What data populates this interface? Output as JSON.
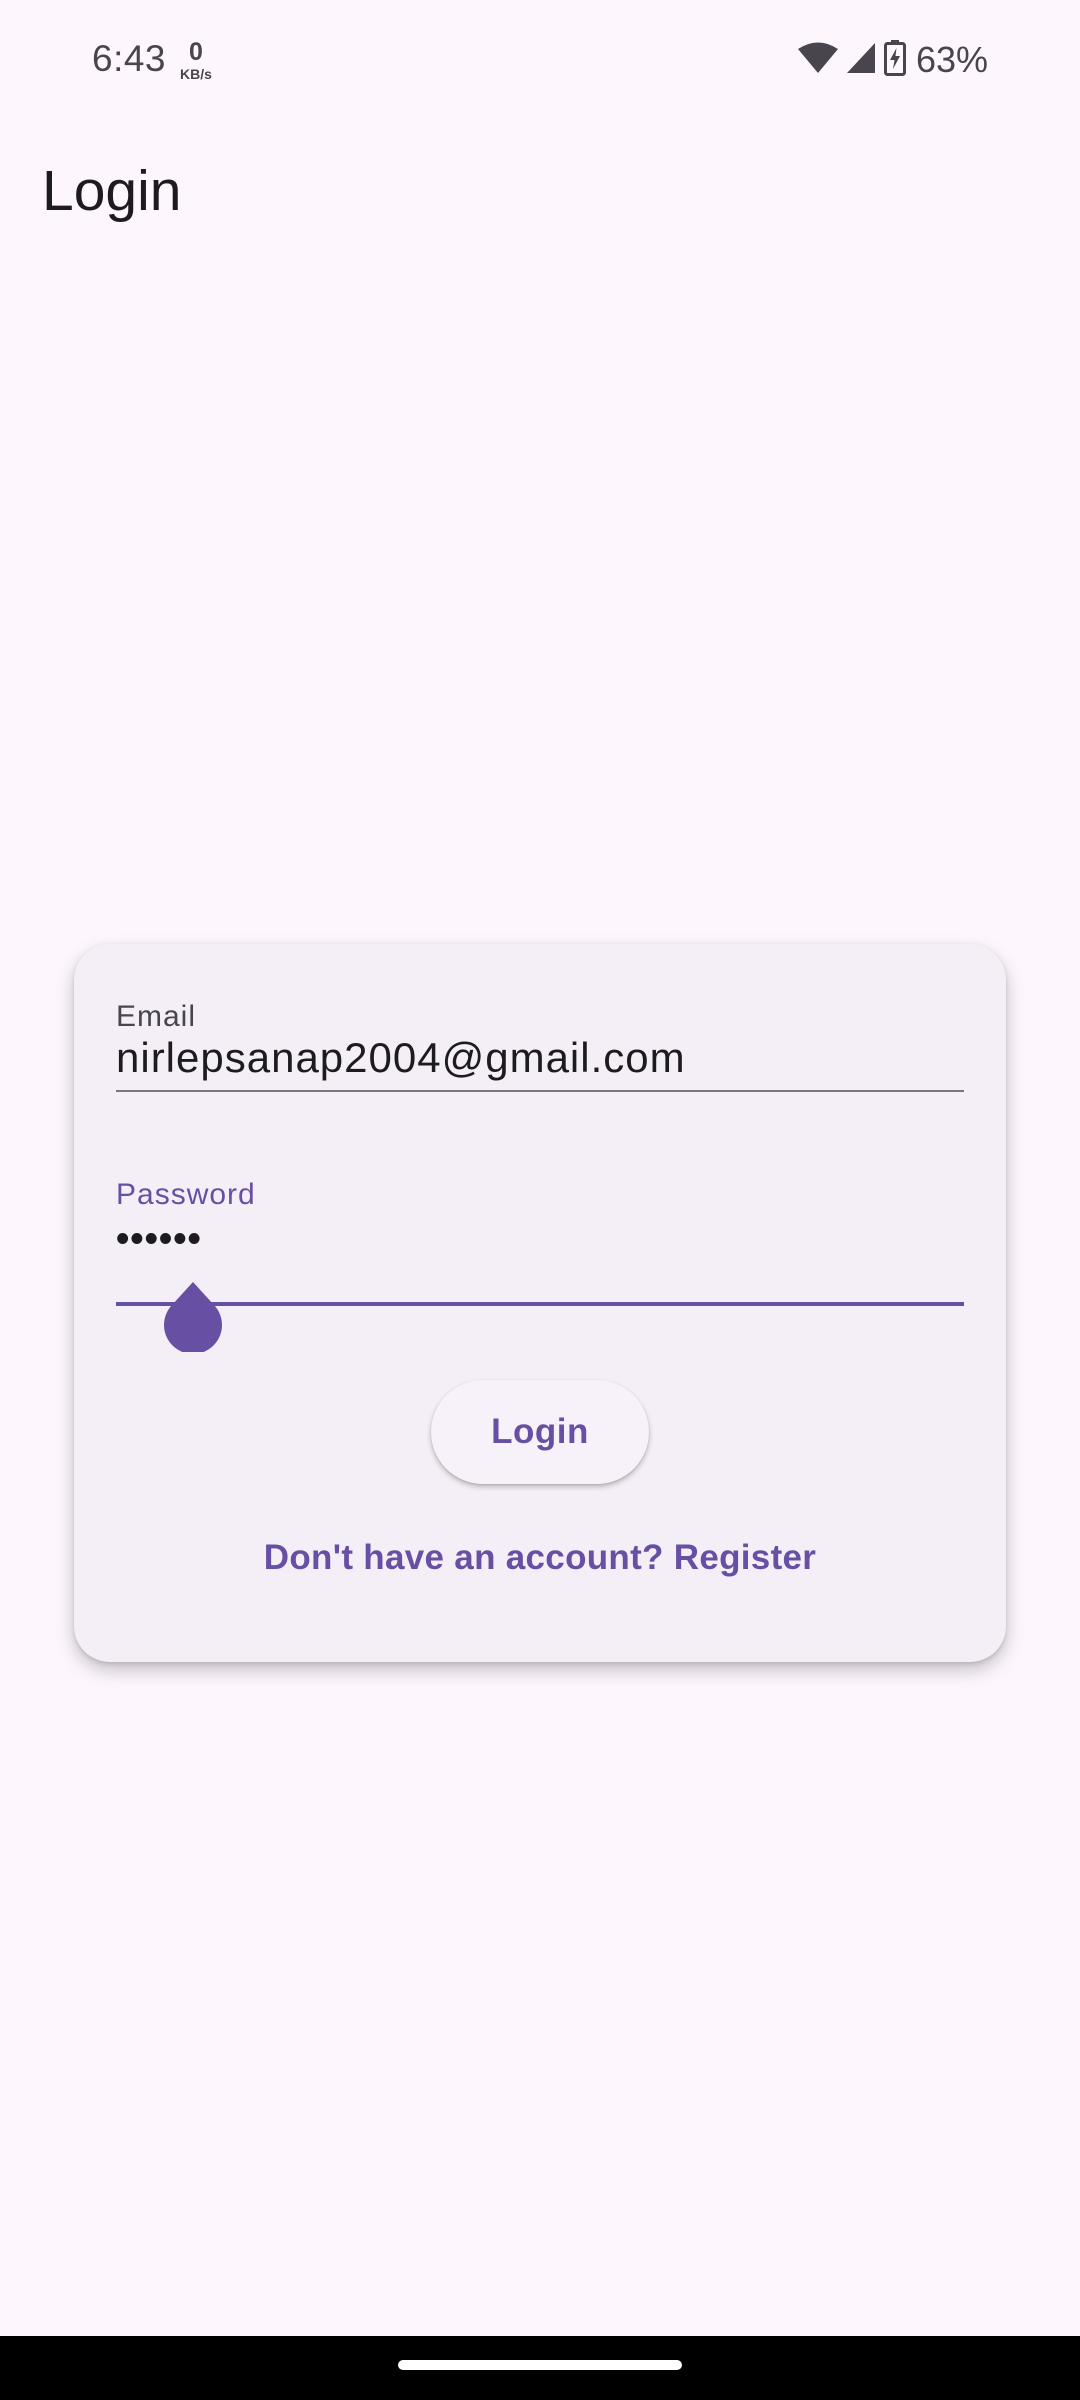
{
  "status_bar": {
    "time": "6:43",
    "net_speed_value": "0",
    "net_speed_unit": "KB/s",
    "battery_percent": "63%",
    "icons": [
      "wifi-icon",
      "cell-signal-icon",
      "battery-charging-icon"
    ]
  },
  "app_bar": {
    "title": "Login"
  },
  "form": {
    "email": {
      "label": "Email",
      "value": "nirlepsanap2004@gmail.com"
    },
    "password": {
      "label": "Password",
      "value": "••••••"
    },
    "login_button_label": "Login",
    "register_link": "Don't have an account? Register"
  },
  "colors": {
    "background": "#fdf7fd",
    "card": "#f4eff6",
    "primary": "#6750a4",
    "text": "#1d1b20",
    "secondary_text": "#49454f"
  }
}
